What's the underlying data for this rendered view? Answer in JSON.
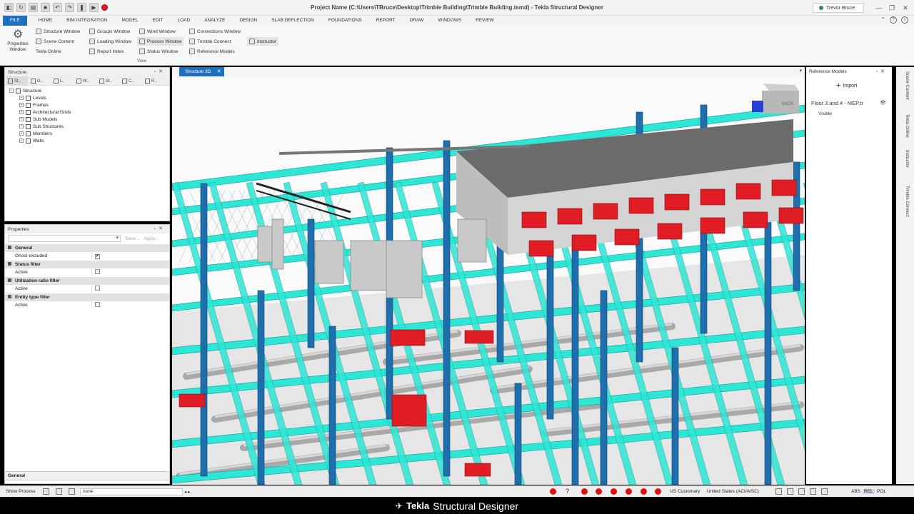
{
  "title": "Project Name (C:\\Users\\TBruce\\Desktop\\Trimble Building\\Trimble Building.tsmd) - Tekla Structural Designer",
  "user": "Trevor Bruce",
  "tabs": [
    "FILE",
    "HOME",
    "BIM INTEGRATION",
    "MODEL",
    "EDIT",
    "LOAD",
    "ANALYZE",
    "DESIGN",
    "SLAB DEFLECTION",
    "FOUNDATIONS",
    "REPORT",
    "DRAW",
    "WINDOWS",
    "REVIEW"
  ],
  "ribbon": {
    "properties_label": "Properties Window",
    "col1": [
      "Structure Window",
      "Scene Content",
      "Tekla Online"
    ],
    "col2": [
      "Groups Window",
      "Loading Window",
      "Report Index"
    ],
    "col3": [
      "Wind Window",
      "Process Window",
      "Status Window"
    ],
    "col4": [
      "Connections Window",
      "Trimble Connect",
      "Reference Models"
    ],
    "col5": [
      "Instructor"
    ],
    "group_label": "View"
  },
  "structure_panel": {
    "title": "Structure",
    "tabs": [
      "St..",
      "G..",
      "L..",
      "W..",
      "St..",
      "C..",
      "R.."
    ],
    "root": "Structure",
    "children": [
      "Levels",
      "Frames",
      "Architectural Grids",
      "Sub Models",
      "Sub Structures",
      "Members",
      "Walls"
    ]
  },
  "properties_panel": {
    "title": "Properties",
    "save": "Save...",
    "apply": "Apply...",
    "sections": [
      {
        "name": "General",
        "row": "Ghost excluded",
        "checked": "✔"
      },
      {
        "name": "Status filter",
        "row": "Active",
        "checked": ""
      },
      {
        "name": "Utilization ratio filter",
        "row": "Active",
        "checked": ""
      },
      {
        "name": "Entity type filter",
        "row": "Active",
        "checked": ""
      }
    ],
    "footer": "General"
  },
  "document_tab": "Structure 3D",
  "reference_panel": {
    "title": "Reference Models",
    "import": "Import",
    "item": "Floor 3 and 4  - MEP.tr",
    "visible": "Visible"
  },
  "side_tabs": [
    "Scene Content",
    "Tekla Online",
    "Instructor",
    "Trimble Connect"
  ],
  "status": {
    "show_process": "Show Process",
    "filter_value": "none",
    "units": "US Customary",
    "code": "United States (ACI/AISC)",
    "abs": "ABS",
    "rel": "REL",
    "pol": "POL"
  },
  "caption": {
    "brand": "Tekla",
    "product": "Structural Designer"
  },
  "colors": {
    "beam_cyan": "#2ee6d6",
    "column_blue": "#1f6fae",
    "equipment_red": "#e01c24",
    "accent_blue": "#1e6fbf"
  }
}
